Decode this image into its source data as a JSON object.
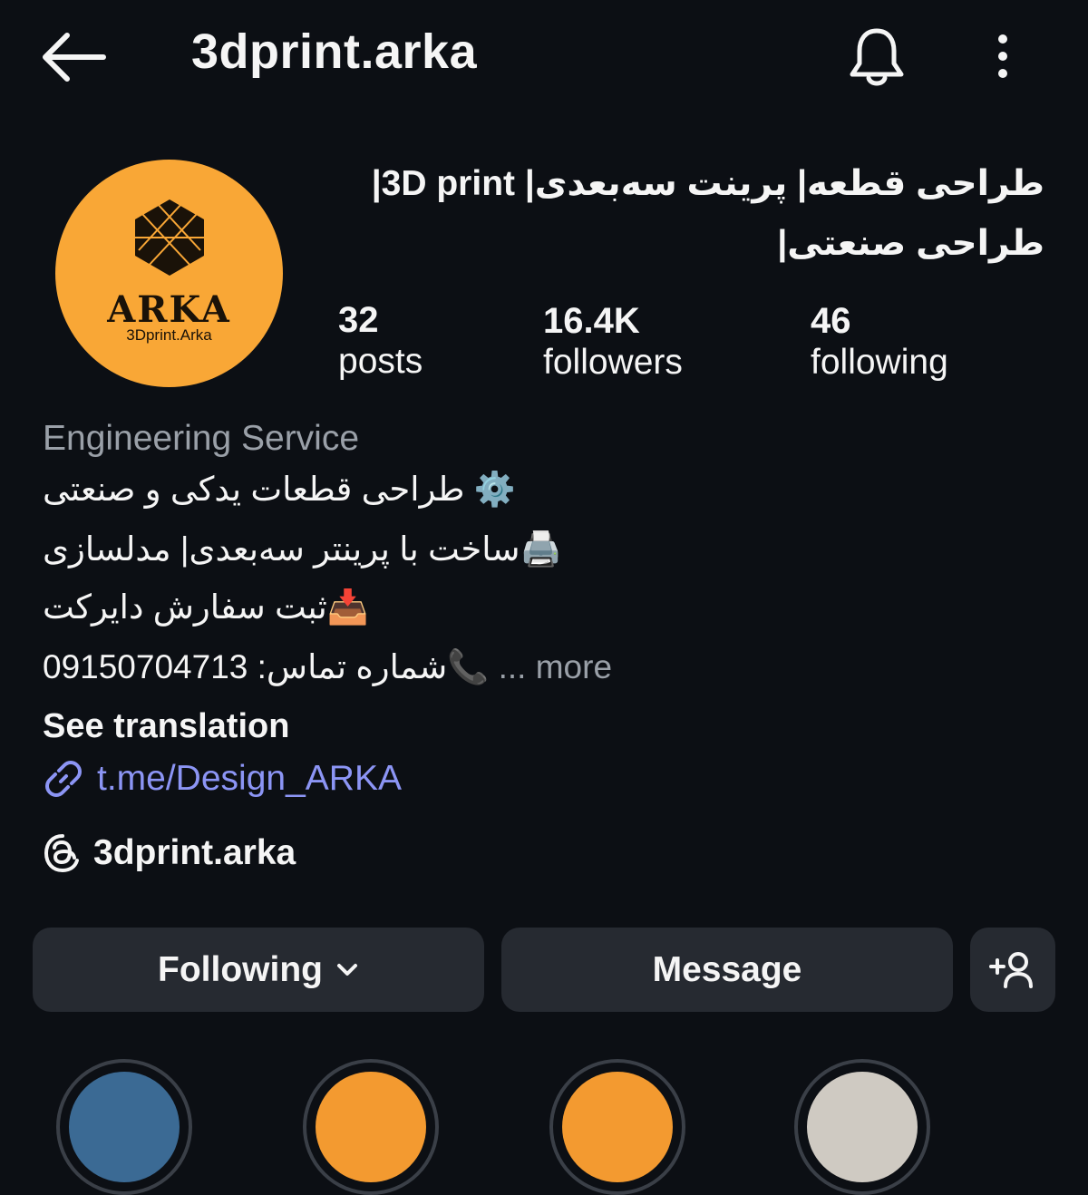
{
  "header": {
    "username": "3dprint.arka",
    "back_icon": "arrow-left-icon",
    "bell_icon": "bell-icon",
    "more_icon": "more-vertical-icon"
  },
  "profile": {
    "full_name": "طراحی قطعه| پرینت سه‌بعدی| 3D print| طراحی صنعتی|",
    "avatar": {
      "brand": "ARKA",
      "handle": "3Dprint.Arka",
      "background": "#f9a736"
    }
  },
  "stats": {
    "posts": {
      "count": "32",
      "label": "posts"
    },
    "followers": {
      "count": "16.4K",
      "label": "followers"
    },
    "following": {
      "count": "46",
      "label": "following"
    }
  },
  "bio": {
    "category": "Engineering Service",
    "line1": "⚙️ طراحی قطعات یدکی و صنعتی",
    "line2": "🖨️ساخت با پرینتر سه‌بعدی| مدلسازی",
    "line3": "📥ثبت سفارش دایرکت",
    "line4": "📞شماره تماس: 09150704713",
    "more": "... more",
    "see_translation": "See translation",
    "link": "t.me/Design_ARKA",
    "threads": "3dprint.arka"
  },
  "actions": {
    "following_label": "Following",
    "message_label": "Message",
    "add_user_icon": "add-person-icon"
  },
  "colors": {
    "background": "#0c0f14",
    "button": "#262a31",
    "link": "#8c95f5",
    "muted": "#9aa0a8",
    "avatar": "#f9a736"
  }
}
